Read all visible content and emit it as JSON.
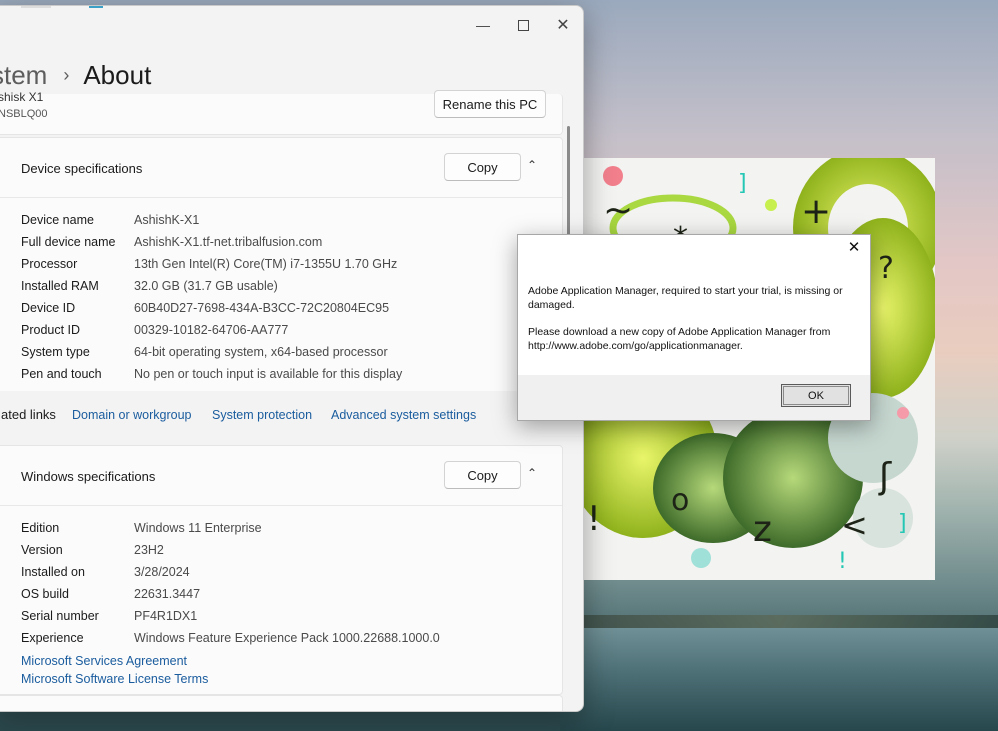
{
  "window": {
    "minimize_icon": "minimize-icon",
    "maximize_icon": "maximize-icon",
    "close_icon": "close-icon"
  },
  "breadcrumb": {
    "parent": "stem",
    "separator": "›",
    "current": "About"
  },
  "pc": {
    "name_partial": "shisk X1",
    "serial_partial": "NSBLQ00",
    "rename_label": "Rename this PC"
  },
  "device_specs": {
    "title": "Device specifications",
    "copy_label": "Copy",
    "rows": [
      {
        "label": "Device name",
        "value": "AshishK-X1"
      },
      {
        "label": "Full device name",
        "value": "AshishK-X1.tf-net.tribalfusion.com"
      },
      {
        "label": "Processor",
        "value": "13th Gen Intel(R) Core(TM) i7-1355U   1.70 GHz"
      },
      {
        "label": "Installed RAM",
        "value": "32.0 GB (31.7 GB usable)"
      },
      {
        "label": "Device ID",
        "value": "60B40D27-7698-434A-B3CC-72C20804EC95"
      },
      {
        "label": "Product ID",
        "value": "00329-10182-64706-AA777"
      },
      {
        "label": "System type",
        "value": "64-bit operating system, x64-based processor"
      },
      {
        "label": "Pen and touch",
        "value": "No pen or touch input is available for this display"
      }
    ]
  },
  "related": {
    "label": "ated links",
    "links": [
      "Domain or workgroup",
      "System protection",
      "Advanced system settings"
    ]
  },
  "windows_specs": {
    "title": "Windows specifications",
    "copy_label": "Copy",
    "rows": [
      {
        "label": "Edition",
        "value": "Windows 11 Enterprise"
      },
      {
        "label": "Version",
        "value": "23H2"
      },
      {
        "label": "Installed on",
        "value": "3/28/2024"
      },
      {
        "label": "OS build",
        "value": "22631.3447"
      },
      {
        "label": "Serial number",
        "value": "PF4R1DX1"
      },
      {
        "label": "Experience",
        "value": "Windows Feature Experience Pack 1000.22688.1000.0"
      }
    ],
    "links": [
      "Microsoft Services Agreement",
      "Microsoft Software License Terms"
    ]
  },
  "dialog": {
    "message1": "Adobe Application Manager, required to start your trial, is missing or damaged.",
    "message2": "Please download a new copy of Adobe Application Manager from http://www.adobe.com/go/applicationmanager.",
    "ok_label": "OK"
  }
}
